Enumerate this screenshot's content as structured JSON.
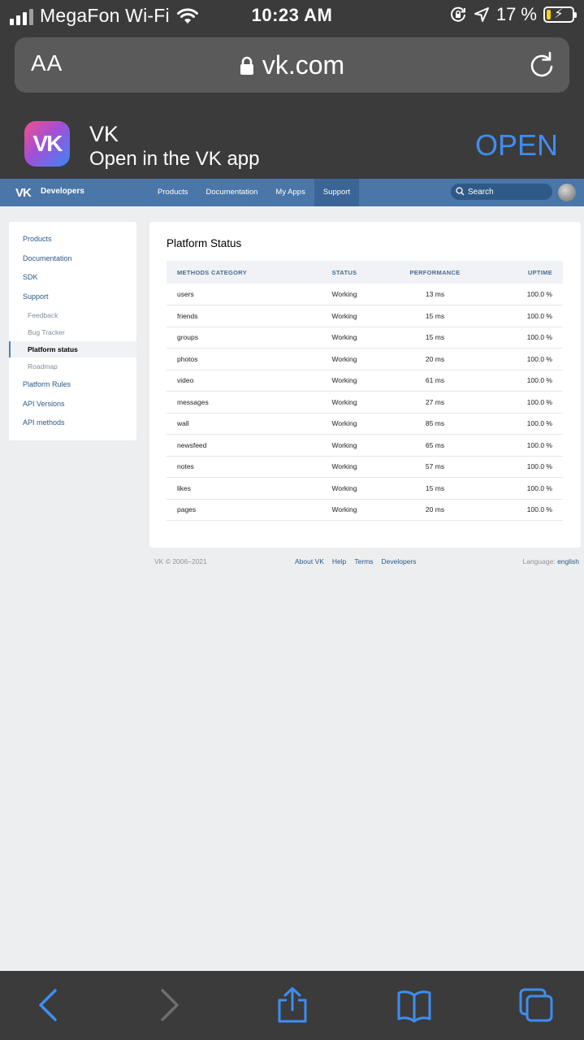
{
  "status_bar": {
    "carrier": "MegaFon Wi-Fi",
    "time": "10:23 AM",
    "battery": "17 %",
    "battery_level": 0.17,
    "icons": [
      "signal-icon",
      "wifi-icon",
      "orientation-lock-icon",
      "location-icon",
      "battery-icon"
    ]
  },
  "browser": {
    "text_size_label": "AA",
    "url": "vk.com",
    "icons": [
      "lock-icon",
      "reload-icon"
    ]
  },
  "app_banner": {
    "title": "VK",
    "subtitle": "Open in the VK app",
    "open_label": "OPEN",
    "accent": "#3e8ef0"
  },
  "header": {
    "brand": "Developers",
    "brand_color": "#4a76a8",
    "nav": [
      "Products",
      "Documentation",
      "My Apps",
      "Support"
    ],
    "active_nav": "Support",
    "search_placeholder": "Search"
  },
  "sidebar": {
    "items": [
      {
        "label": "Products"
      },
      {
        "label": "Documentation"
      },
      {
        "label": "SDK"
      },
      {
        "label": "Support"
      },
      {
        "label": "Feedback"
      },
      {
        "label": "Bug Tracker"
      },
      {
        "label": "Platform status"
      },
      {
        "label": "Roadmap"
      },
      {
        "label": "Platform Rules"
      },
      {
        "label": "API Versions"
      },
      {
        "label": "API methods"
      }
    ],
    "current": "Platform status"
  },
  "main": {
    "title": "Platform Status",
    "columns": [
      "Methods category",
      "Status",
      "Performance",
      "Uptime"
    ],
    "rows": [
      {
        "category": "users",
        "status": "Working",
        "performance": "13 ms",
        "uptime": "100.0 %"
      },
      {
        "category": "friends",
        "status": "Working",
        "performance": "15 ms",
        "uptime": "100.0 %"
      },
      {
        "category": "groups",
        "status": "Working",
        "performance": "15 ms",
        "uptime": "100.0 %"
      },
      {
        "category": "photos",
        "status": "Working",
        "performance": "20 ms",
        "uptime": "100.0 %"
      },
      {
        "category": "video",
        "status": "Working",
        "performance": "61 ms",
        "uptime": "100.0 %"
      },
      {
        "category": "messages",
        "status": "Working",
        "performance": "27 ms",
        "uptime": "100.0 %"
      },
      {
        "category": "wall",
        "status": "Working",
        "performance": "85 ms",
        "uptime": "100.0 %"
      },
      {
        "category": "newsfeed",
        "status": "Working",
        "performance": "65 ms",
        "uptime": "100.0 %"
      },
      {
        "category": "notes",
        "status": "Working",
        "performance": "57 ms",
        "uptime": "100.0 %"
      },
      {
        "category": "likes",
        "status": "Working",
        "performance": "15 ms",
        "uptime": "100.0 %"
      },
      {
        "category": "pages",
        "status": "Working",
        "performance": "20 ms",
        "uptime": "100.0 %"
      }
    ]
  },
  "footer": {
    "copyright": "VK © 2006–2021",
    "links": [
      "About VK",
      "Help",
      "Terms",
      "Developers"
    ],
    "language_label": "Language:",
    "language_value": "english"
  },
  "toolbar": {
    "icons": [
      "back-icon",
      "forward-icon",
      "share-icon",
      "bookmarks-icon",
      "tabs-icon"
    ]
  }
}
